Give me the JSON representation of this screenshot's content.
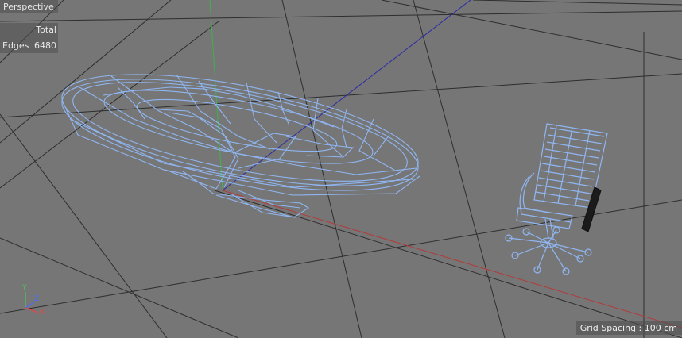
{
  "viewport": {
    "view_name": "Perspective",
    "hud": {
      "header": "Total",
      "row_label": "Edges",
      "row_value": "6480"
    },
    "grid_spacing_label": "Grid Spacing : 100 cm"
  },
  "axis_gizmo": {
    "y_label": "Y",
    "z_label": "Z",
    "x_label": "X"
  },
  "colors": {
    "background": "#767676",
    "grid_line": "#2e2e2e",
    "wireframe": "#8fb6f2",
    "axis_x": "#b43a3a",
    "axis_y": "#3fb34a",
    "axis_z": "#2b2ba8"
  },
  "scene_objects": [
    "table-wireframe",
    "office-chair-wireframe"
  ]
}
